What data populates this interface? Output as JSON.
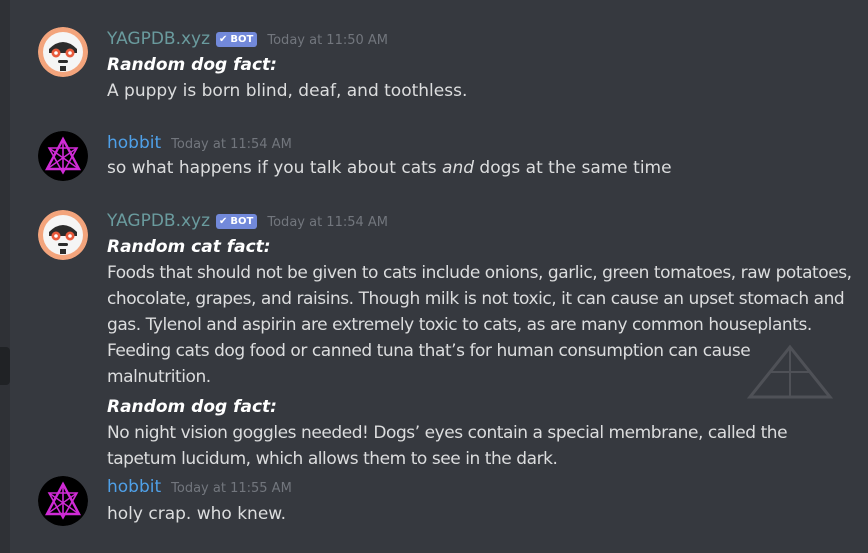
{
  "colors": {
    "background": "#36393f",
    "sidebar": "#2f3136",
    "bot_name": "#6a9b9e",
    "user_name": "#4fa0e8",
    "bot_badge": "#7289da",
    "timestamp": "#72767d",
    "text": "#dcddde"
  },
  "messages": [
    {
      "author": "YAGPDB.xyz",
      "is_bot": true,
      "badge": "BOT",
      "timestamp": "Today at 11:50 AM",
      "avatar_icon": "robot-face-icon",
      "heading": "Random dog fact:",
      "text": "A puppy is born blind, deaf, and toothless."
    },
    {
      "author": "hobbit",
      "is_bot": false,
      "timestamp": "Today at 11:54 AM",
      "avatar_icon": "pentagram-triangle-icon",
      "text_before": "so what happens if you talk about cats ",
      "text_emphasis": "and",
      "text_after": " dogs at the same time"
    },
    {
      "author": "YAGPDB.xyz",
      "is_bot": true,
      "badge": "BOT",
      "timestamp": "Today at 11:54 AM",
      "avatar_icon": "robot-face-icon",
      "heading": "Random cat fact:",
      "text": "Foods that should not be given to cats include onions, garlic, green tomatoes, raw potatoes, chocolate, grapes, and raisins. Though milk is not toxic, it can cause an upset stomach and gas. Tylenol and aspirin are extremely toxic to cats, as are many common houseplants. Feeding cats dog food or canned tuna that’s for human consumption can cause malnutrition.",
      "heading2": "Random dog fact:",
      "text2": "No night vision goggles needed! Dogs’ eyes contain a special membrane, called the tapetum lucidum, which allows them to see in the dark."
    },
    {
      "author": "hobbit",
      "is_bot": false,
      "timestamp": "Today at 11:55 AM",
      "avatar_icon": "pentagram-triangle-icon",
      "text": "holy crap. who knew."
    }
  ]
}
